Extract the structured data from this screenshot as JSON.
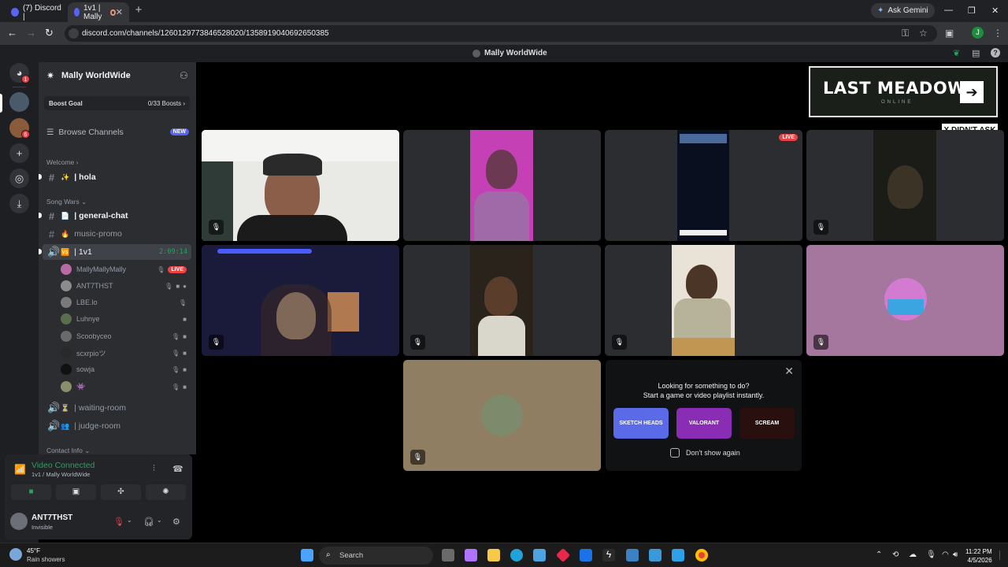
{
  "browser": {
    "tabs": [
      {
        "title": "(7) Discord |",
        "fav_color": "#5865f2"
      },
      {
        "title": "1v1 | Mally",
        "fav_color": "#5865f2"
      }
    ],
    "new_tab": "+",
    "ask_gemini": "Ask Gemini",
    "url": "discord.com/channels/1260129773846528020/1358919040692650385",
    "profile_initial": "J"
  },
  "discord_title": "Mally WorldWide",
  "rail": {
    "home_badge": "1",
    "server_badge": "6"
  },
  "server": {
    "name": "Mally WorldWide",
    "boost_goal_label": "Boost Goal",
    "boost_goal_value": "0/33 Boosts",
    "browse_channels": "Browse Channels",
    "new_badge": "NEW",
    "categories": {
      "welcome": "Welcome",
      "song_wars": "Song Wars",
      "contact_info": "Contact Info"
    },
    "channels": {
      "hola": "hola",
      "general_chat": "general-chat",
      "music_promo": "music-promo",
      "one_v_one": "1v1",
      "one_v_one_timer": "2:09:14",
      "waiting_room": "waiting-room",
      "judge_room": "judge-room"
    },
    "voice_users": [
      {
        "name": "MallyMallyMally",
        "live": "LIVE"
      },
      {
        "name": "ANT7THST"
      },
      {
        "name": "LBE.lo"
      },
      {
        "name": "Luhnye"
      },
      {
        "name": "Scoobyceo"
      },
      {
        "name": "scxrpioツ"
      },
      {
        "name": "sowja"
      },
      {
        "name": "👾"
      }
    ]
  },
  "voice_panel": {
    "status": "Video Connected",
    "sub": "1v1 / Mally WorldWide"
  },
  "user": {
    "name": "ANT7THST",
    "status": "Invisible"
  },
  "stage": {
    "live_label": "LIVE",
    "banner_title": "LAST MEADOW",
    "banner_sub": "ONLINE",
    "sticker_text": "X DIDN'T ASK",
    "activity": {
      "line1": "Looking for something to do?",
      "line2": "Start a game or video playlist instantly.",
      "games": [
        "SKETCH HEADS",
        "VALORANT",
        "SCREAM"
      ],
      "dont_show": "Don't show again"
    }
  },
  "taskbar": {
    "temp": "45°F",
    "weather": "Rain showers",
    "search": "Search",
    "time": "11:22 PM",
    "date": "4/5/2026"
  }
}
